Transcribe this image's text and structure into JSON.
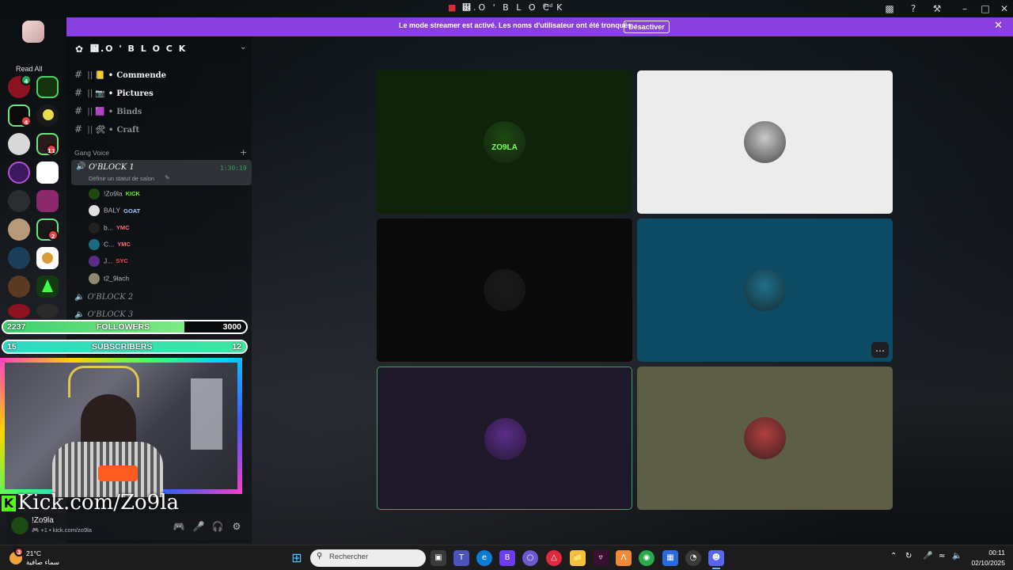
{
  "app": {
    "title": "୼.O ' B L O C K"
  },
  "banner": {
    "text": "Le mode streamer est activé. Les noms d'utilisateur ont été tronqués.",
    "button": "Désactiver"
  },
  "rail": {
    "read_all": "Read All",
    "badges": [
      "4",
      "4",
      "11",
      "2"
    ]
  },
  "server": {
    "name": "୼.O ' B L O C K"
  },
  "channels": [
    {
      "name": "Commende",
      "emoji": "📒",
      "dim": false
    },
    {
      "name": "Pictures",
      "emoji": "📷",
      "dim": false
    },
    {
      "name": "Binds",
      "emoji": "🟪",
      "dim": true
    },
    {
      "name": "Craft",
      "emoji": "🛠",
      "dim": true
    }
  ],
  "voice_category": "Gang Voice",
  "active_voice": {
    "name": "O'BLOCK 1",
    "timer": "1:30:19",
    "status_placeholder": "Définir un statut de salon"
  },
  "voice_members": [
    {
      "name": "!Zo9la",
      "tag": "KICK",
      "tag_color": "#53fc18",
      "avatar": "#1d4a12"
    },
    {
      "name": "BALY",
      "tag": "GOAT",
      "tag_color": "#9ec9ff",
      "avatar": "#e0e0e0"
    },
    {
      "name": "b...",
      "tag": "YMC",
      "tag_color": "#ff6b6b",
      "avatar": "#222222"
    },
    {
      "name": "C...",
      "tag": "YMC",
      "tag_color": "#ff6b6b",
      "avatar": "#1b6a80"
    },
    {
      "name": "J...",
      "tag": "SYC",
      "tag_color": "#ff4444",
      "avatar": "#5b2d8a"
    },
    {
      "name": "t2_9lach",
      "tag": "",
      "tag_color": "#ffffff",
      "avatar": "#8c8a6a"
    }
  ],
  "other_voice": [
    "O'BLOCK 2",
    "O'BLOCK 3"
  ],
  "overlay": {
    "followers": {
      "current": "2237",
      "label": "FOLLOWERS",
      "goal": "3000",
      "progress": 0.746
    },
    "subscribers": {
      "current": "15",
      "label": "SUBSCRIBERS",
      "goal": "12",
      "progress": 1.0
    },
    "kick_url": "Kick.com/Zo9la"
  },
  "user": {
    "name": "!Zo9la",
    "status": "🎮 +1 • kick.com/zo9la"
  },
  "tiles": [
    {
      "id": "zo9la",
      "bg": "#0f230a",
      "avatar": "#1d4a12",
      "label": "ZO9LA",
      "active": false
    },
    {
      "id": "baly",
      "bg": "#ececec",
      "avatar": "#c9c9c9",
      "label": "",
      "active": false
    },
    {
      "id": "member3",
      "bg": "#0a0a0a",
      "avatar": "#1a1a1a",
      "label": "",
      "active": false
    },
    {
      "id": "member4",
      "bg": "#0d4a63",
      "avatar": "#1f6f8a",
      "label": "",
      "active": false
    },
    {
      "id": "member5",
      "bg": "#1d1928",
      "avatar": "#5b2d8a",
      "label": "",
      "active": true
    },
    {
      "id": "member6",
      "bg": "#5d5e46",
      "avatar": "#b04040",
      "label": "",
      "active": false
    }
  ],
  "taskbar": {
    "weather_badge": "3",
    "temperature": "21°C",
    "weather_desc": "سماء صافية",
    "search_placeholder": "Rechercher",
    "time": "00:11",
    "date": "02/10/2025"
  }
}
